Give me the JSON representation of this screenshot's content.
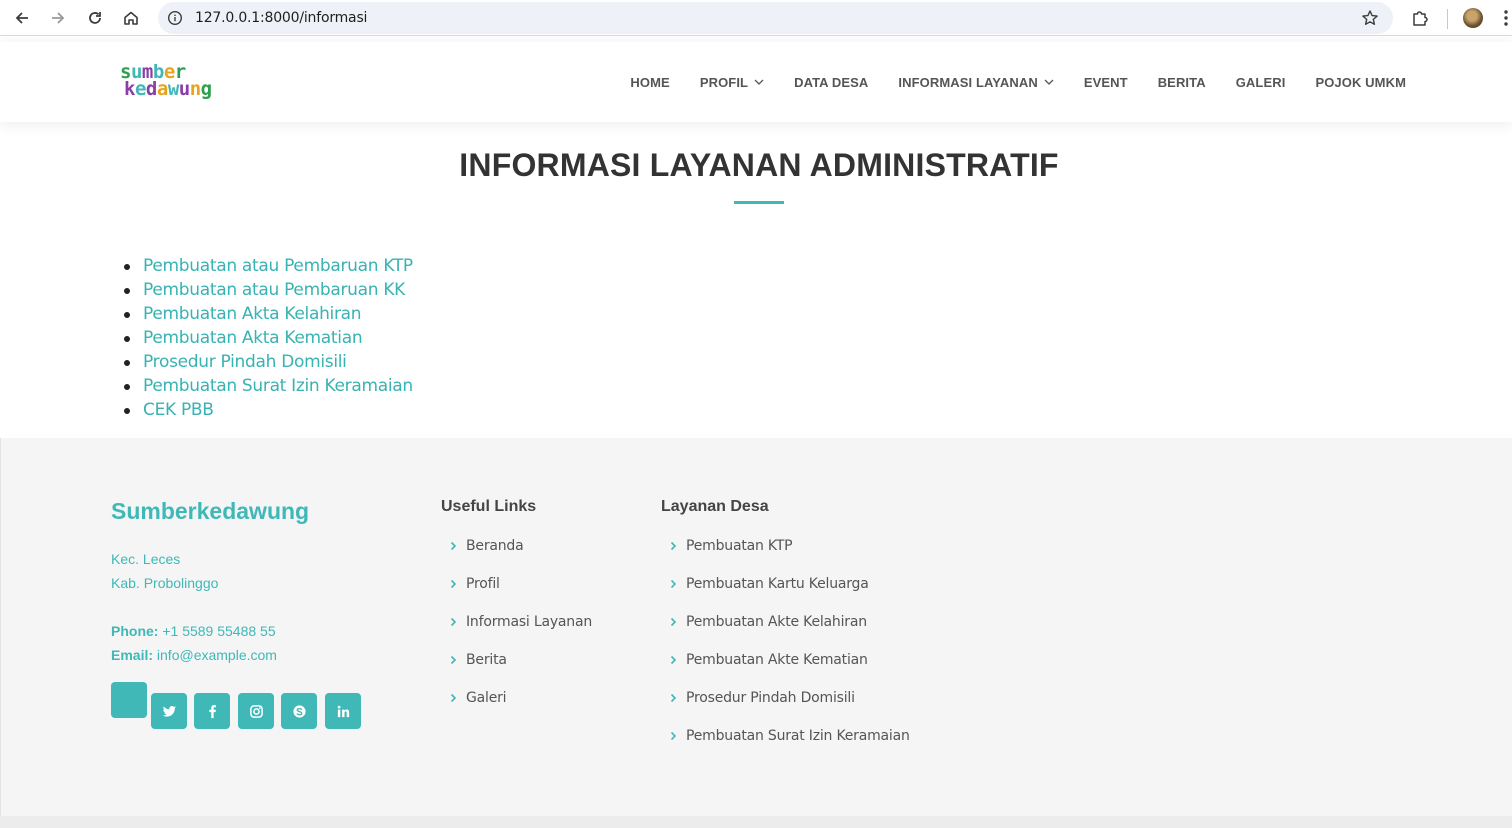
{
  "browser": {
    "url": "127.0.0.1:8000/informasi",
    "back_icon": "arrow-left-icon",
    "forward_icon": "arrow-right-icon",
    "reload_icon": "reload-icon",
    "home_icon": "home-icon",
    "info_icon": "info-icon",
    "bookmark_icon": "star-icon",
    "extensions_icon": "puzzle-icon",
    "menu_icon": "kebab-menu-icon"
  },
  "header": {
    "logo_line1": "sumber",
    "logo_line2": "kedawung",
    "nav": [
      {
        "label": "HOME",
        "dropdown": false
      },
      {
        "label": "PROFIL",
        "dropdown": true
      },
      {
        "label": "DATA DESA",
        "dropdown": false
      },
      {
        "label": "INFORMASI LAYANAN",
        "dropdown": true
      },
      {
        "label": "EVENT",
        "dropdown": false
      },
      {
        "label": "BERITA",
        "dropdown": false
      },
      {
        "label": "GALERI",
        "dropdown": false
      },
      {
        "label": "POJOK UMKM",
        "dropdown": false
      }
    ]
  },
  "main": {
    "title": "INFORMASI LAYANAN ADMINISTRATIF",
    "services": [
      "Pembuatan atau Pembaruan KTP",
      "Pembuatan atau Pembaruan KK",
      "Pembuatan Akta Kelahiran",
      "Pembuatan Akta Kematian",
      "Prosedur Pindah Domisili",
      "Pembuatan Surat Izin Keramaian",
      "CEK PBB"
    ]
  },
  "footer": {
    "brand": "Sumberkedawung",
    "address_line1": "Kec. Leces",
    "address_line2": "Kab. Probolinggo",
    "phone_label": "Phone:",
    "phone": "+1 5589 55488 55",
    "email_label": "Email:",
    "email": "info@example.com",
    "social_icons": [
      "twitter-icon",
      "facebook-icon",
      "instagram-icon",
      "skype-icon",
      "linkedin-icon"
    ],
    "useful_links_title": "Useful Links",
    "useful_links": [
      "Beranda",
      "Profil",
      "Informasi Layanan",
      "Berita",
      "Galeri"
    ],
    "layanan_title": "Layanan Desa",
    "layanan_links": [
      "Pembuatan KTP",
      "Pembuatan Kartu Keluarga",
      "Pembuatan Akte Kelahiran",
      "Pembuatan Akte Kematian",
      "Prosedur Pindah Domisili",
      "Pembuatan Surat Izin Keramaian"
    ]
  },
  "colors": {
    "accent": "#3fb8b7",
    "text": "#444444",
    "footer_bg": "#f5f5f5"
  }
}
